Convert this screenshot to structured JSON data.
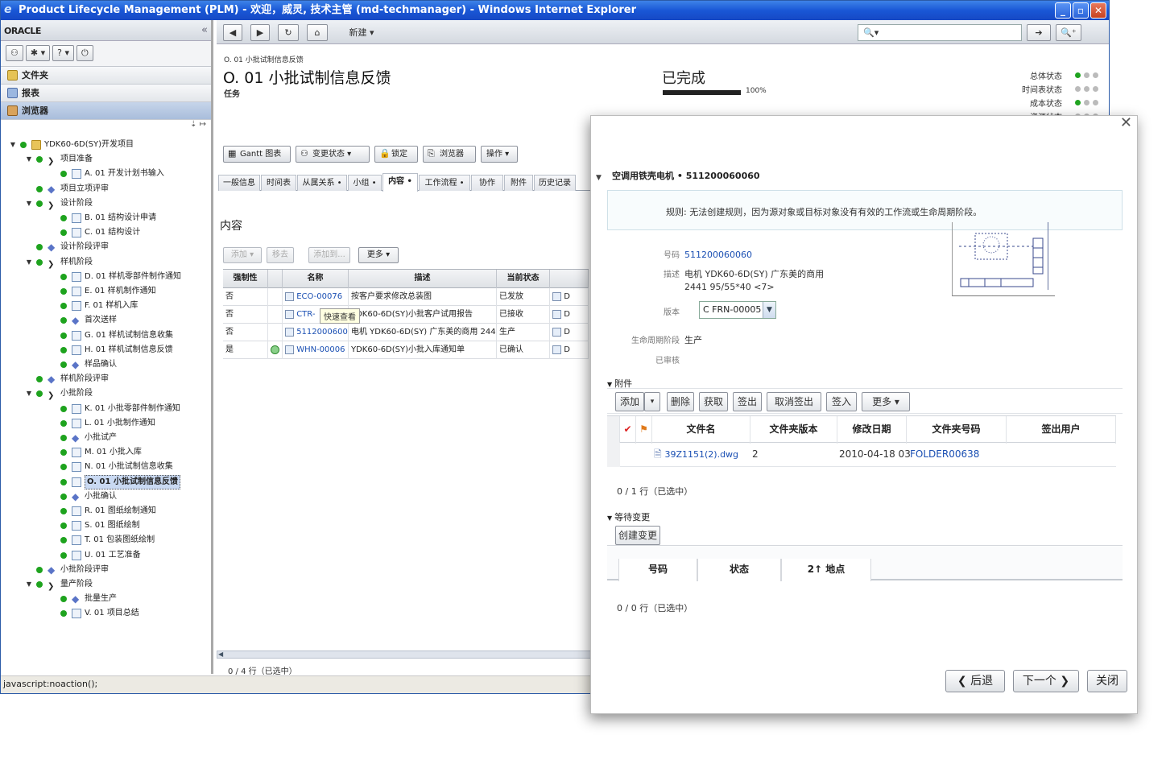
{
  "window": {
    "title": "Product Lifecycle Management (PLM) - 欢迎，威灵, 技术主管 (md-techmanager) - Windows Internet Explorer",
    "controls": [
      "_",
      "▫",
      "✕"
    ]
  },
  "left": {
    "logo": "ORACLE",
    "collapse": "«",
    "toolbar": [
      "⚇",
      "✱ ▾",
      "? ▾",
      "⏻"
    ],
    "sections": [
      {
        "label": "文件夹",
        "active": false
      },
      {
        "label": "报表",
        "active": false
      },
      {
        "label": "浏览器",
        "active": true
      }
    ],
    "tree_tools": "⇣ ↦",
    "tree": [
      {
        "label": "YDK60-6D(SY)开发项目",
        "level": 0,
        "icon": "folder-icon",
        "toggle": "▼",
        "dot": true
      },
      {
        "label": "项目准备",
        "level": 1,
        "icon": "chevron",
        "toggle": "▼",
        "dot": true
      },
      {
        "label": "A. 01 开发计划书输入",
        "level": 2,
        "icon": "task",
        "toggle": "",
        "dot": true
      },
      {
        "label": "项目立项评审",
        "level": 1,
        "icon": "diamond",
        "toggle": "",
        "dot": true
      },
      {
        "label": "设计阶段",
        "level": 1,
        "icon": "chevron",
        "toggle": "▼",
        "dot": true
      },
      {
        "label": "B. 01 结构设计申请",
        "level": 2,
        "icon": "task",
        "toggle": "",
        "dot": true
      },
      {
        "label": "C. 01 结构设计",
        "level": 2,
        "icon": "task",
        "toggle": "",
        "dot": true
      },
      {
        "label": "设计阶段评审",
        "level": 1,
        "icon": "diamond",
        "toggle": "",
        "dot": true
      },
      {
        "label": "样机阶段",
        "level": 1,
        "icon": "chevron",
        "toggle": "▼",
        "dot": true
      },
      {
        "label": "D. 01 样机零部件制作通知",
        "level": 2,
        "icon": "task",
        "toggle": "",
        "dot": true
      },
      {
        "label": "E. 01 样机制作通知",
        "level": 2,
        "icon": "task",
        "toggle": "",
        "dot": true
      },
      {
        "label": "F. 01 样机入库",
        "level": 2,
        "icon": "task",
        "toggle": "",
        "dot": true
      },
      {
        "label": "首次送样",
        "level": 2,
        "icon": "diamond",
        "toggle": "",
        "dot": true
      },
      {
        "label": "G. 01 样机试制信息收集",
        "level": 2,
        "icon": "task",
        "toggle": "",
        "dot": true
      },
      {
        "label": "H. 01 样机试制信息反馈",
        "level": 2,
        "icon": "task",
        "toggle": "",
        "dot": true
      },
      {
        "label": "样品确认",
        "level": 2,
        "icon": "diamond",
        "toggle": "",
        "dot": true
      },
      {
        "label": "样机阶段评审",
        "level": 1,
        "icon": "diamond",
        "toggle": "",
        "dot": true
      },
      {
        "label": "小批阶段",
        "level": 1,
        "icon": "chevron",
        "toggle": "▼",
        "dot": true
      },
      {
        "label": "K. 01 小批零部件制作通知",
        "level": 2,
        "icon": "task",
        "toggle": "",
        "dot": true
      },
      {
        "label": "L. 01 小批制作通知",
        "level": 2,
        "icon": "task",
        "toggle": "",
        "dot": true
      },
      {
        "label": "小批试产",
        "level": 2,
        "icon": "diamond",
        "toggle": "",
        "dot": true
      },
      {
        "label": "M. 01 小批入库",
        "level": 2,
        "icon": "task",
        "toggle": "",
        "dot": true
      },
      {
        "label": "N. 01 小批试制信息收集",
        "level": 2,
        "icon": "task",
        "toggle": "",
        "dot": true
      },
      {
        "label": "O. 01 小批试制信息反馈",
        "level": 2,
        "icon": "task",
        "toggle": "",
        "dot": true,
        "selected": true
      },
      {
        "label": "小批确认",
        "level": 2,
        "icon": "diamond",
        "toggle": "",
        "dot": true
      },
      {
        "label": "R. 01 图纸绘制通知",
        "level": 2,
        "icon": "task",
        "toggle": "",
        "dot": true
      },
      {
        "label": "S. 01 图纸绘制",
        "level": 2,
        "icon": "task",
        "toggle": "",
        "dot": true
      },
      {
        "label": "T. 01 包装图纸绘制",
        "level": 2,
        "icon": "task",
        "toggle": "",
        "dot": true
      },
      {
        "label": "U. 01 工艺准备",
        "level": 2,
        "icon": "task",
        "toggle": "",
        "dot": true
      },
      {
        "label": "小批阶段评审",
        "level": 1,
        "icon": "diamond",
        "toggle": "",
        "dot": true
      },
      {
        "label": "量产阶段",
        "level": 1,
        "icon": "chevron",
        "toggle": "▼",
        "dot": true
      },
      {
        "label": "批量生产",
        "level": 2,
        "icon": "diamond",
        "toggle": "",
        "dot": true
      },
      {
        "label": "V. 01 项目总结",
        "level": 2,
        "icon": "task",
        "toggle": "",
        "dot": true
      }
    ]
  },
  "statusbar": "javascript:noaction();",
  "main_toolbar": {
    "back": "◀",
    "forward": "▶",
    "refresh": "↻",
    "home": "⌂",
    "new_menu": "新建 ▾",
    "search_placeholder": "🔍▾",
    "go": "➔",
    "search_btn": "🔍⁺"
  },
  "main": {
    "breadcrumb": "O. 01 小批试制信息反馈",
    "title": "O. 01 小批试制信息反馈",
    "subtitle": "任务",
    "status_text": "已完成",
    "progress": 1.0,
    "progress_label": "100%",
    "statuses": [
      {
        "label": "总体状态",
        "dots": [
          "g",
          "n",
          "n"
        ]
      },
      {
        "label": "时间表状态",
        "dots": [
          "n",
          "n",
          "n"
        ]
      },
      {
        "label": "成本状态",
        "dots": [
          "g",
          "n",
          "n"
        ]
      },
      {
        "label": "资源状态",
        "dots": [
          "n",
          "n",
          "n"
        ]
      }
    ],
    "actions": [
      {
        "label": "Gantt 图表",
        "icon": "▦"
      },
      {
        "label": "变更状态 ▾",
        "icon": "⚇"
      },
      {
        "label": "锁定",
        "icon": "🔒"
      },
      {
        "label": "浏览器",
        "icon": "⎘"
      },
      {
        "label": "操作 ▾",
        "icon": ""
      }
    ],
    "tabs": [
      "一般信息",
      "时间表",
      "从属关系 •",
      "小组 •",
      "内容 •",
      "工作流程 •",
      "协作",
      "附件",
      "历史记录"
    ],
    "active_tab": 4,
    "section_title": "内容",
    "content_tools": [
      "添加 ▾",
      "移去",
      "添加到...",
      "更多 ▾"
    ],
    "grid_headers": [
      "强制性",
      "",
      "名称",
      "描述",
      "当前状态",
      ""
    ],
    "grid_rows": [
      {
        "mandatory": "否",
        "check": "",
        "name": "ECO-00076",
        "desc": "按客户要求修改总装图",
        "state": "已发放",
        "tail": "D"
      },
      {
        "mandatory": "否",
        "check": "",
        "name": "CTR-",
        "desc": "YDK60-6D(SY)小批客户试用报告",
        "state": "已接收",
        "tail": "D"
      },
      {
        "mandatory": "否",
        "check": "",
        "name": "511200060060",
        "desc": "电机 YDK60-6D(SY) 广东美的商用 244",
        "state": "生产",
        "tail": "D"
      },
      {
        "mandatory": "是",
        "check": "✓",
        "name": "WHN-00006",
        "desc": "YDK60-6D(SY)小批入库通知单",
        "state": "已确认",
        "tail": "D"
      }
    ],
    "tooltip": "快速查看",
    "row_count": "0 / 4 行（已选中）"
  },
  "dialog": {
    "close": "✕",
    "title": "空调用铁壳电机 • 511200060060",
    "rule_label": "规则:",
    "rule_text": "无法创建规则，因为源对象或目标对象没有有效的工作流或生命周期阶段。",
    "fields": [
      {
        "label": "号码",
        "value": "511200060060",
        "link": true
      },
      {
        "label": "描述",
        "value": "电机 YDK60-6D(SY) 广东美的商用",
        "link": false
      },
      {
        "label": "",
        "value": "2441 95/55*40 <7>",
        "link": false
      }
    ],
    "version_label": "版本",
    "version_value": "C FRN-00005",
    "lifecycle_label": "生命周期阶段",
    "lifecycle_value": "生产",
    "audit_label": "已审核",
    "attachments_label": "附件",
    "att_buttons": [
      "添加",
      "▾",
      "删除",
      "获取",
      "签出",
      "取消签出",
      "签入",
      "更多 ▾"
    ],
    "att_headers": [
      "",
      "",
      "文件名",
      "文件夹版本",
      "修改日期",
      "文件夹号码",
      "签出用户"
    ],
    "att_rows": [
      {
        "file": "39Z1151(2).dwg",
        "version": "2",
        "date": "2010-04-18 03",
        "folder": "FOLDER00638",
        "user": ""
      }
    ],
    "att_count": "0 / 1 行（已选中）",
    "pending_label": "等待变更",
    "create_change": "创建变更",
    "chg_headers": [
      "号码",
      "状态",
      "2↑ 地点"
    ],
    "chg_count": "0 / 0 行（已选中）",
    "back": "后退",
    "next": "下一个",
    "close_btn": "关闭"
  }
}
